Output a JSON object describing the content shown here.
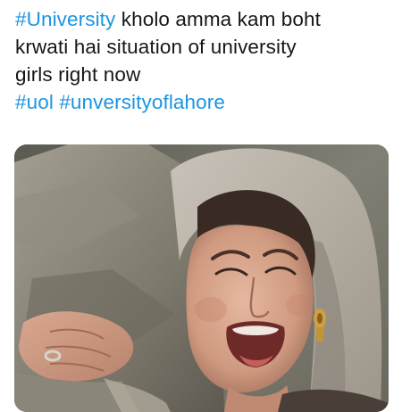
{
  "tweet": {
    "hashtag_main": "#University",
    "text_line1_rest": " kholo amma kam boht",
    "text_line2": "krwati hai situation of university",
    "text_line3": "girls right now",
    "hashtag_uol": "#uol",
    "hashtag_lahore": "#unversityoflahore"
  },
  "colors": {
    "text": "#14171a",
    "hashtag": "#1b95e0",
    "background": "#ffffff"
  }
}
